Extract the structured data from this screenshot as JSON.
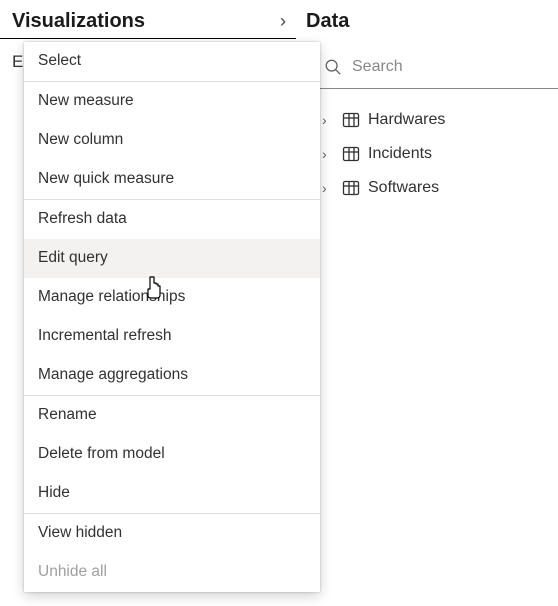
{
  "viz_panel": {
    "title": "Visualizations",
    "build_prefix": "E"
  },
  "data_panel": {
    "title": "Data"
  },
  "search": {
    "placeholder": "Search"
  },
  "tables": [
    {
      "name": "Hardwares"
    },
    {
      "name": "Incidents"
    },
    {
      "name": "Softwares"
    }
  ],
  "context_menu": {
    "items": [
      {
        "label": "Select",
        "disabled": false,
        "hovered": false,
        "sep": false
      },
      {
        "label": "New measure",
        "disabled": false,
        "hovered": false,
        "sep": true
      },
      {
        "label": "New column",
        "disabled": false,
        "hovered": false,
        "sep": false
      },
      {
        "label": "New quick measure",
        "disabled": false,
        "hovered": false,
        "sep": false
      },
      {
        "label": "Refresh data",
        "disabled": false,
        "hovered": false,
        "sep": true
      },
      {
        "label": "Edit query",
        "disabled": false,
        "hovered": true,
        "sep": false
      },
      {
        "label": "Manage relationships",
        "disabled": false,
        "hovered": false,
        "sep": false
      },
      {
        "label": "Incremental refresh",
        "disabled": false,
        "hovered": false,
        "sep": false
      },
      {
        "label": "Manage aggregations",
        "disabled": false,
        "hovered": false,
        "sep": false
      },
      {
        "label": "Rename",
        "disabled": false,
        "hovered": false,
        "sep": true
      },
      {
        "label": "Delete from model",
        "disabled": false,
        "hovered": false,
        "sep": false
      },
      {
        "label": "Hide",
        "disabled": false,
        "hovered": false,
        "sep": false
      },
      {
        "label": "View hidden",
        "disabled": false,
        "hovered": false,
        "sep": true
      },
      {
        "label": "Unhide all",
        "disabled": true,
        "hovered": false,
        "sep": false
      }
    ]
  }
}
